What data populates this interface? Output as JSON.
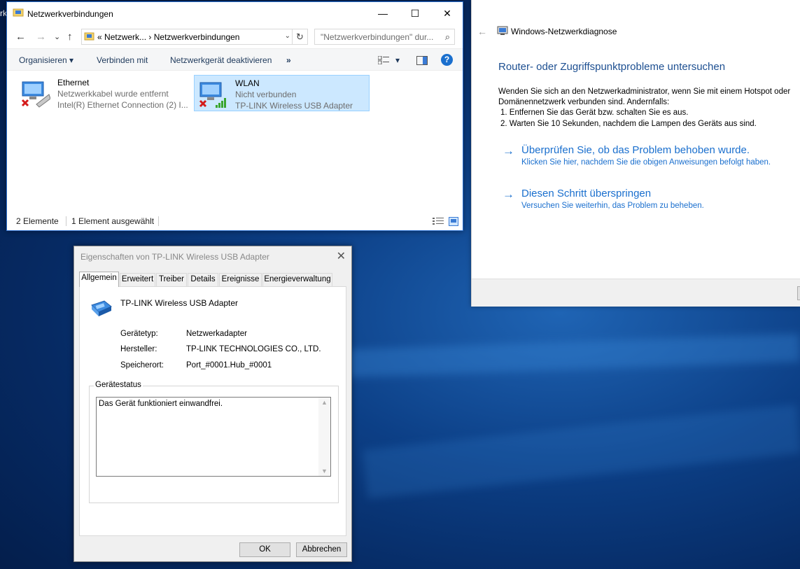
{
  "desktop": {
    "edge_text": "rk"
  },
  "explorer": {
    "title": "Netzwerkverbindungen",
    "window_buttons": {
      "minimize": "—",
      "maximize": "☐",
      "close": "✕"
    },
    "nav": {
      "back": "←",
      "forward": "→",
      "recent": "⌄",
      "up": "↑"
    },
    "address": {
      "prefix": "«",
      "part1": "Netzwerk...",
      "sep": "›",
      "part2": "Netzwerkverbindungen",
      "dropdown": "⌄",
      "refresh": "↻"
    },
    "search": {
      "placeholder": "\"Netzwerkverbindungen\" dur...",
      "icon": "⌕"
    },
    "commands": {
      "organize": "Organisieren ▾",
      "connect": "Verbinden mit",
      "disable": "Netzwerkgerät deaktivieren",
      "more": "»",
      "view_dd": "▾",
      "help": "?"
    },
    "connections": [
      {
        "name": "Ethernet",
        "status": "Netzwerkkabel wurde entfernt",
        "device": "Intel(R) Ethernet Connection (2) I..."
      },
      {
        "name": "WLAN",
        "status": "Nicht verbunden",
        "device": "TP-LINK Wireless USB Adapter"
      }
    ],
    "statusbar": {
      "count": "2 Elemente",
      "selected": "1 Element ausgewählt"
    }
  },
  "diagnose": {
    "back": "←",
    "title": "Windows-Netzwerkdiagnose",
    "heading": "Router- oder Zugriffspunktprobleme untersuchen",
    "para1": "Wenden Sie sich an den Netzwerkadministrator, wenn Sie mit einem Hotspot oder",
    "para2": "Domänennetzwerk verbunden sind. Andernfalls:",
    "step1": "1. Entfernen Sie das Gerät bzw. schalten Sie es aus.",
    "step2": "2. Warten Sie 10 Sekunden, nachdem die Lampen des Geräts aus sind.",
    "option1": {
      "arrow": "→",
      "title": "Überprüfen Sie, ob das Problem behoben wurde.",
      "desc": "Klicken Sie hier, nachdem Sie die obigen Anweisungen befolgt haben."
    },
    "option2": {
      "arrow": "→",
      "title": "Diesen Schritt überspringen",
      "desc": "Versuchen Sie weiterhin, das Problem zu beheben."
    }
  },
  "properties": {
    "title": "Eigenschaften von TP-LINK Wireless USB Adapter",
    "close": "✕",
    "tabs": [
      "Allgemein",
      "Erweitert",
      "Treiber",
      "Details",
      "Ereignisse",
      "Energieverwaltung"
    ],
    "device_name": "TP-LINK Wireless USB Adapter",
    "fields": [
      {
        "label": "Gerätetyp:",
        "value": "Netzwerkadapter"
      },
      {
        "label": "Hersteller:",
        "value": "TP-LINK TECHNOLOGIES CO., LTD."
      },
      {
        "label": "Speicherort:",
        "value": "Port_#0001.Hub_#0001"
      }
    ],
    "group_label": "Gerätestatus",
    "status_text": "Das Gerät funktioniert einwandfrei.",
    "scroll_up": "▲",
    "scroll_down": "▼",
    "ok": "OK",
    "cancel": "Abbrechen"
  }
}
